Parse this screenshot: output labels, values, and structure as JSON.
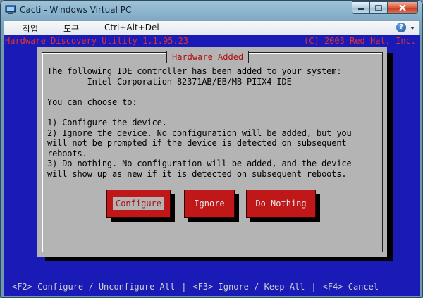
{
  "window": {
    "title": "Cacti - Windows Virtual PC",
    "min_glyph": "—",
    "max_glyph": "□",
    "close_glyph": "✕"
  },
  "menu": {
    "items": [
      "작업",
      "도구",
      "Ctrl+Alt+Del"
    ],
    "help_glyph": "?"
  },
  "console": {
    "header_left": "Hardware Discovery Utility 1.1.95.23",
    "header_right": "(C) 2003 Red Hat, Inc.",
    "dialog": {
      "title": "Hardware Added",
      "body": "The following IDE controller has been added to your system:\n        Intel Corporation 82371AB/EB/MB PIIX4 IDE\n\nYou can choose to:\n\n1) Configure the device.\n2) Ignore the device. No configuration will be added, but you\nwill not be prompted if the device is detected on subsequent\nreboots.\n3) Do nothing. No configuration will be added, and the device\nwill show up as new if it is detected on subsequent reboots.",
      "buttons": [
        {
          "label": "Configure",
          "focused": true
        },
        {
          "label": "Ignore",
          "focused": false
        },
        {
          "label": "Do Nothing",
          "focused": false
        }
      ]
    },
    "footer": {
      "items": [
        "<F2> Configure / Unconfigure All",
        "<F3> Ignore / Keep All",
        "<F4> Cancel"
      ],
      "separator": "|"
    }
  },
  "colors": {
    "console_bg": "#1a1ab6",
    "header_text": "#e03030",
    "dialog_bg": "#b4b4b4",
    "button_bg": "#c01818"
  }
}
